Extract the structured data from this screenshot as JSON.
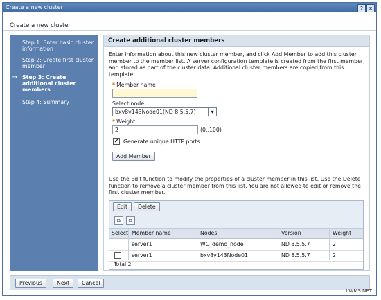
{
  "window": {
    "title": "Create a new cluster",
    "help": "?",
    "close": "x"
  },
  "dialog_title": "Create a new cluster",
  "steps": [
    {
      "label": "Step 1: Enter basic cluster information",
      "active": false
    },
    {
      "label": "Step 2: Create first cluster member",
      "active": false
    },
    {
      "label": "Step 3: Create additional cluster members",
      "active": true
    },
    {
      "label": "Step 4: Summary",
      "active": false
    }
  ],
  "current_step_arrow": "→",
  "panel": {
    "heading": "Create additional cluster members",
    "intro": "Enter information about this new cluster member, and click Add Member to add this cluster member to the member list. A server configuration template is created from the first member, and stored as part of the cluster data. Additional cluster members are copied from this template.",
    "required_marker": "*",
    "member_name": {
      "label": "Member name",
      "value": ""
    },
    "select_node": {
      "label": "Select node",
      "value": "bxv8v143Node01(ND 8.5.5.7)"
    },
    "weight": {
      "label": "Weight",
      "value": "2",
      "range": "(0..100)"
    },
    "generate_ports": {
      "label": "Generate unique HTTP ports",
      "checked": true
    },
    "add_member_button": "Add Member",
    "edit_help": "Use the Edit function to modify the properties of a cluster member in this list. Use the Delete function to remove a cluster member from this list. You are not allowed to edit or remove the first cluster member.",
    "table": {
      "buttons": {
        "edit": "Edit",
        "delete": "Delete"
      },
      "icons": [
        "select-all-icon",
        "deselect-all-icon"
      ],
      "columns": [
        "Select",
        "Member name",
        "Nodes",
        "Version",
        "Weight"
      ],
      "rows": [
        {
          "select": false,
          "member_name": "server1",
          "nodes": "WC_demo_node",
          "version": "ND 8.5.5.7",
          "weight": "2",
          "has_checkbox": false
        },
        {
          "select": false,
          "member_name": "server1",
          "nodes": "bxv8v143Node01",
          "version": "ND 8.5.5.7",
          "weight": "2",
          "has_checkbox": true
        }
      ],
      "total": "Total 2"
    }
  },
  "footer": {
    "previous": "Previous",
    "next": "Next",
    "cancel": "Cancel"
  },
  "watermark": "IIWMS.NET"
}
